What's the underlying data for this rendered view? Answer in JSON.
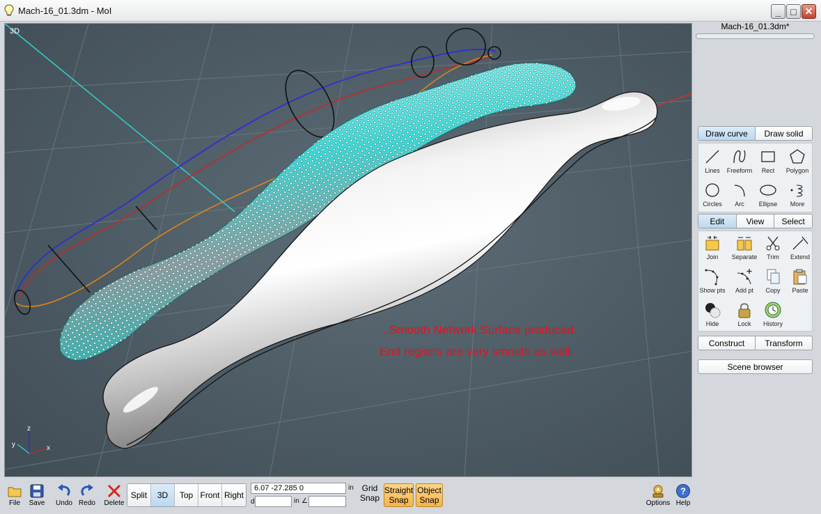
{
  "window": {
    "title": "Mach-16_01.3dm - MoI"
  },
  "viewport": {
    "label": "3D",
    "annotation_line1": "...Smooth Network Surface produced.",
    "annotation_line2": "End regions are very smooth as well.",
    "axis_z": "z",
    "axis_y": "y",
    "axis_x": "x"
  },
  "panel": {
    "file_name": "Mach-16_01.3dm*",
    "draw_tabs": [
      "Draw curve",
      "Draw solid"
    ],
    "draw_tools": [
      {
        "label": "Lines",
        "icon": "line-icon"
      },
      {
        "label": "Freeform",
        "icon": "freeform-icon"
      },
      {
        "label": "Rect",
        "icon": "rect-icon"
      },
      {
        "label": "Polygon",
        "icon": "polygon-icon"
      },
      {
        "label": "Circles",
        "icon": "circle-icon"
      },
      {
        "label": "Arc",
        "icon": "arc-icon"
      },
      {
        "label": "Ellipse",
        "icon": "ellipse-icon"
      },
      {
        "label": "More",
        "icon": "more-icon"
      }
    ],
    "edit_tabs": [
      "Edit",
      "View",
      "Select"
    ],
    "edit_tools": [
      {
        "label": "Join",
        "icon": "join-icon"
      },
      {
        "label": "Separate",
        "icon": "separate-icon"
      },
      {
        "label": "Trim",
        "icon": "scissors-icon"
      },
      {
        "label": "Extend",
        "icon": "extend-icon"
      },
      {
        "label": "Show pts",
        "icon": "show-points-icon"
      },
      {
        "label": "Add pt",
        "icon": "add-point-icon"
      },
      {
        "label": "Copy",
        "icon": "copy-icon"
      },
      {
        "label": "Paste",
        "icon": "paste-icon"
      },
      {
        "label": "Hide",
        "icon": "hide-icon"
      },
      {
        "label": "Lock",
        "icon": "lock-icon"
      },
      {
        "label": "History",
        "icon": "history-icon"
      }
    ],
    "construct_tabs": [
      "Construct",
      "Transform"
    ],
    "scene_browser": "Scene browser"
  },
  "toolbar": {
    "file": "File",
    "save": "Save",
    "undo": "Undo",
    "redo": "Redo",
    "delete": "Delete",
    "views": [
      "Split",
      "3D",
      "Top",
      "Front",
      "Right"
    ],
    "coords": "6.07      -27.285    0",
    "coords_unit": "in",
    "distance_prefix": "d",
    "distance_unit": "in",
    "angle_symbol": "∠",
    "grid_snap": [
      "Grid",
      "Snap"
    ],
    "straight_snap": [
      "Straight",
      "Snap"
    ],
    "object_snap": [
      "Object",
      "Snap"
    ],
    "options": "Options",
    "help": "Help"
  }
}
